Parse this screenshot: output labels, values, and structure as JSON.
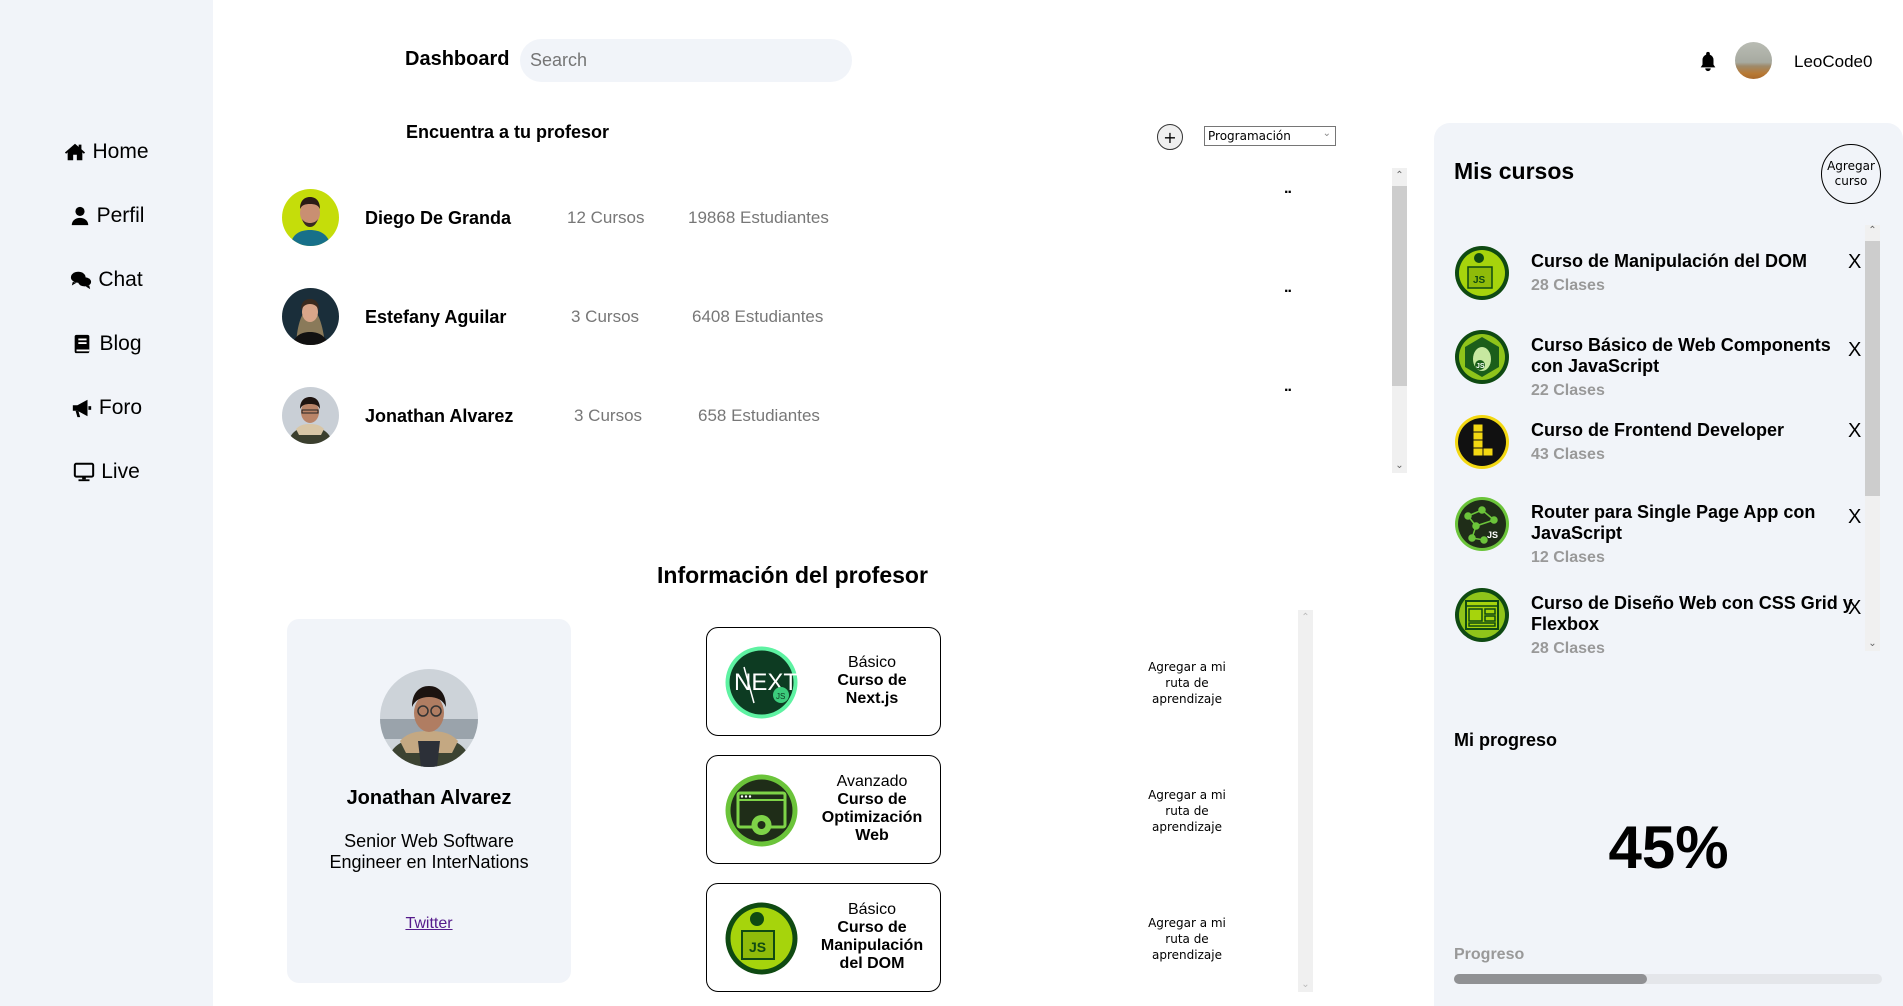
{
  "sidebar": {
    "items": [
      {
        "label": "Home",
        "icon": "home-icon"
      },
      {
        "label": "Perfil",
        "icon": "user-icon"
      },
      {
        "label": "Chat",
        "icon": "chat-icon"
      },
      {
        "label": "Blog",
        "icon": "book-icon"
      },
      {
        "label": "Foro",
        "icon": "megaphone-icon"
      },
      {
        "label": "Live",
        "icon": "monitor-icon"
      }
    ]
  },
  "header": {
    "title": "Dashboard",
    "search_placeholder": "Search",
    "username": "LeoCode0"
  },
  "teachers": {
    "title": "Encuentra a tu profesor",
    "add_label": "+",
    "category": "Programación",
    "more_label": "..",
    "list": [
      {
        "name": "Diego De Granda",
        "courses": "12 Cursos",
        "students": "19868 Estudiantes"
      },
      {
        "name": "Estefany Aguilar",
        "courses": "3 Cursos",
        "students": "6408 Estudiantes"
      },
      {
        "name": "Jonathan Alvarez",
        "courses": "3 Cursos",
        "students": "658 Estudiantes"
      }
    ]
  },
  "teacher_info": {
    "title": "Información del profesor",
    "name": "Jonathan Alvarez",
    "role": "Senior Web Software Engineer en InterNations",
    "link": "Twitter",
    "add_route_label": "Agregar a mi ruta de aprendizaje",
    "courses": [
      {
        "level": "Básico",
        "name": "Curso de Next.js",
        "icon": "nextjs-icon"
      },
      {
        "level": "Avanzado",
        "name": "Curso de Optimización Web",
        "icon": "web-optimization-icon"
      },
      {
        "level": "Básico",
        "name": "Curso de Manipulación del DOM",
        "icon": "dom-js-icon"
      }
    ]
  },
  "my_courses": {
    "title": "Mis cursos",
    "add_label": "Agregar curso",
    "remove_label": "X",
    "list": [
      {
        "name": "Curso de Manipulación del DOM",
        "classes": "28 Clases",
        "icon": "dom-js-icon"
      },
      {
        "name": "Curso Básico de Web Components con JavaScript",
        "classes": "22 Clases",
        "icon": "web-components-icon"
      },
      {
        "name": "Curso de Frontend Developer",
        "classes": "43 Clases",
        "icon": "frontend-icon"
      },
      {
        "name": "Router para Single Page App con JavaScript",
        "classes": "12 Clases",
        "icon": "router-spa-icon"
      },
      {
        "name": "Curso de Diseño Web con CSS Grid y Flexbox",
        "classes": "28 Clases",
        "icon": "css-grid-icon"
      }
    ]
  },
  "progress": {
    "title": "Mi progreso",
    "percent_label": "45%",
    "bar_label": "Progreso",
    "value": 45
  }
}
